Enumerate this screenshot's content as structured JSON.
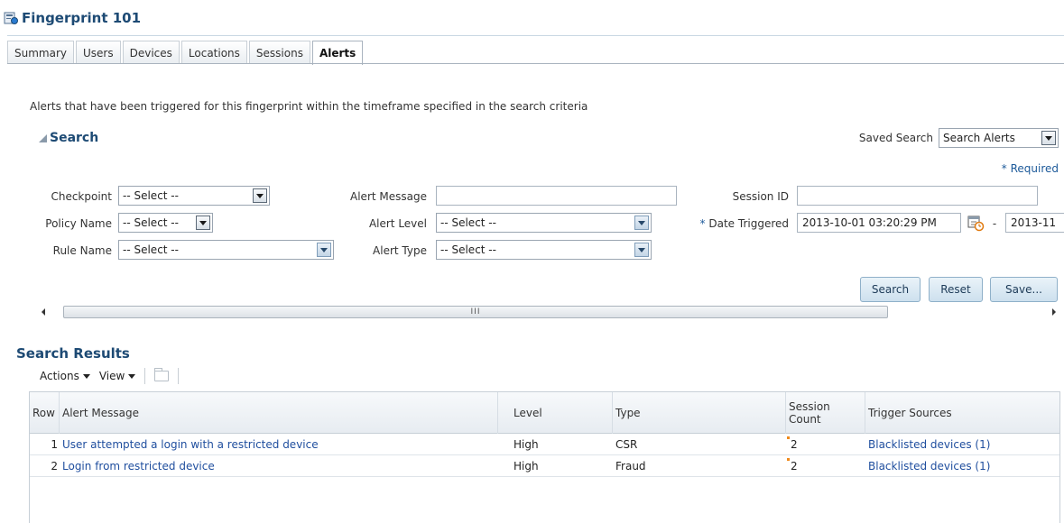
{
  "page": {
    "title": "Fingerprint 101",
    "tabs": [
      "Summary",
      "Users",
      "Devices",
      "Locations",
      "Sessions",
      "Alerts"
    ],
    "active_tab": "Alerts",
    "description": "Alerts that have been triggered for this fingerprint within the timeframe specified in the search criteria"
  },
  "search": {
    "title": "Search",
    "saved_search_label": "Saved Search",
    "saved_search_value": "Search Alerts",
    "required_label": "Required",
    "fields": {
      "checkpoint_label": "Checkpoint",
      "checkpoint_value": "-- Select --",
      "policy_name_label": "Policy Name",
      "policy_name_value": "-- Select --",
      "rule_name_label": "Rule Name",
      "rule_name_value": "-- Select --",
      "alert_message_label": "Alert Message",
      "alert_message_value": "",
      "alert_level_label": "Alert Level",
      "alert_level_value": "-- Select --",
      "alert_type_label": "Alert Type",
      "alert_type_value": "-- Select --",
      "session_id_label": "Session ID",
      "session_id_value": "",
      "date_triggered_label": "Date Triggered",
      "date_from": "2013-10-01 03:20:29 PM",
      "date_separator": "-",
      "date_to": "2013-11"
    },
    "buttons": {
      "search": "Search",
      "reset": "Reset",
      "save": "Save..."
    },
    "scroll_thumb_grip": "III"
  },
  "results": {
    "title": "Search Results",
    "actions_label": "Actions",
    "view_label": "View",
    "columns": [
      "Row",
      "Alert Message",
      "Level",
      "Type",
      "Session Count",
      "Trigger Sources"
    ],
    "rows": [
      {
        "row": "1",
        "message": "User attempted a login with a restricted device",
        "level": "High",
        "type": "CSR",
        "session_count": "2",
        "trigger_sources": "Blacklisted devices (1)"
      },
      {
        "row": "2",
        "message": "Login from restricted device",
        "level": "High",
        "type": "Fraud",
        "session_count": "2",
        "trigger_sources": "Blacklisted devices (1)"
      }
    ]
  },
  "colors": {
    "title": "#1d4a74",
    "link": "#1f4e9e",
    "marker": "#f08a1c"
  }
}
